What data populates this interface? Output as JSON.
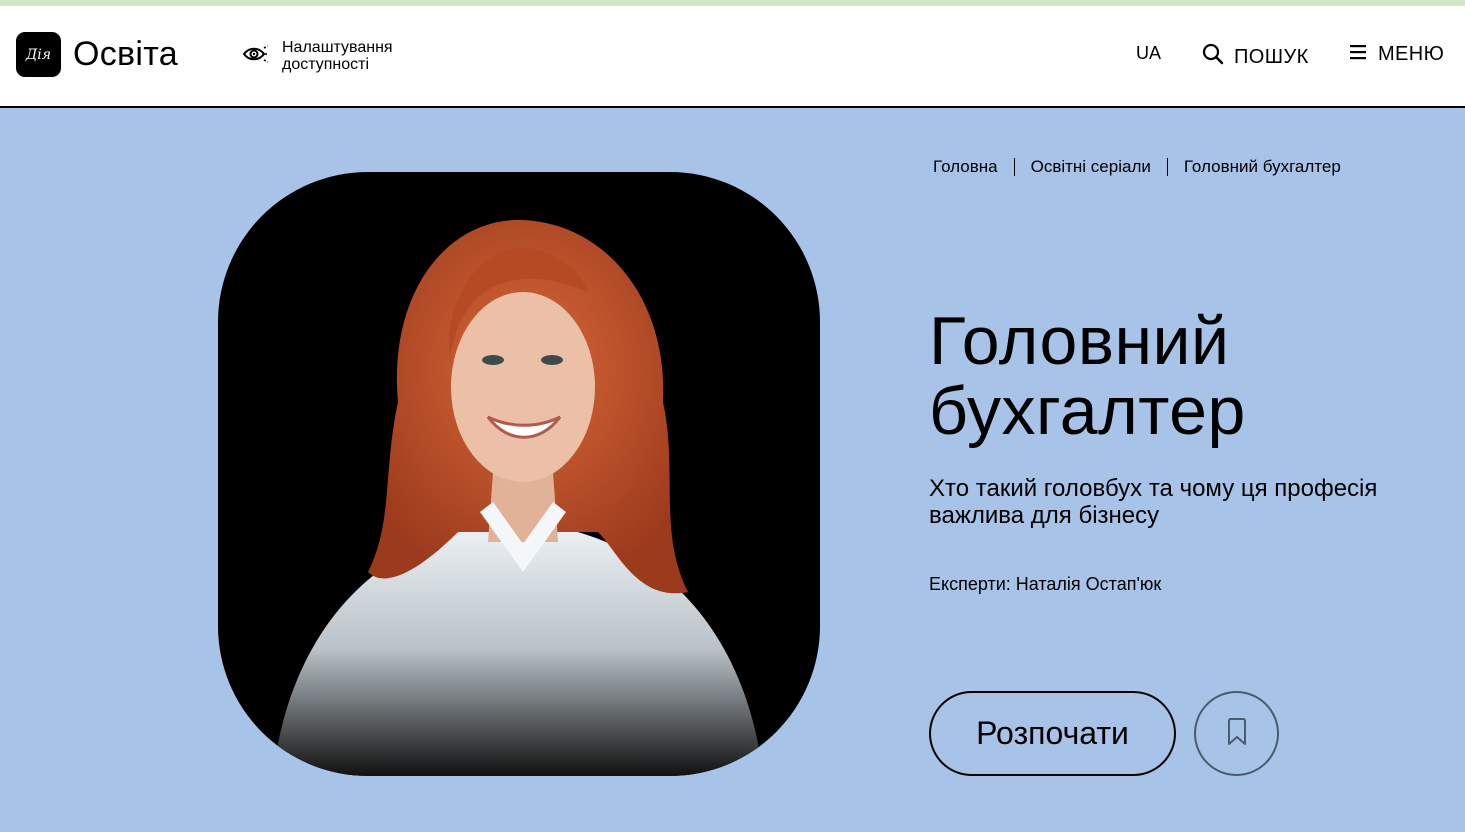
{
  "header": {
    "logo_mark": "Дія",
    "logo_text": "Освіта",
    "accessibility_label": "Налаштування доступності",
    "lang": "UA",
    "search_label": "ПОШУК",
    "menu_label": "МЕНЮ"
  },
  "breadcrumb": [
    "Головна",
    "Освітні серіали",
    "Головний бухгалтер"
  ],
  "course": {
    "title": "Головний бухгалтер",
    "subtitle": "Хто такий головбух та чому ця професія важлива для бізнесу",
    "experts": "Експерти: Наталія Остап'юк",
    "start_label": "Розпочати"
  },
  "icons": {
    "accessibility": "eye-icon",
    "search": "search-icon",
    "menu": "hamburger-icon",
    "bookmark": "bookmark-icon"
  },
  "colors": {
    "background": "#a7c4e8",
    "header_bg": "#ffffff",
    "top_strip": "#cfe6c8",
    "photo_bg": "#000000",
    "hair": "#c4552a",
    "shirt": "#e8eef2"
  }
}
